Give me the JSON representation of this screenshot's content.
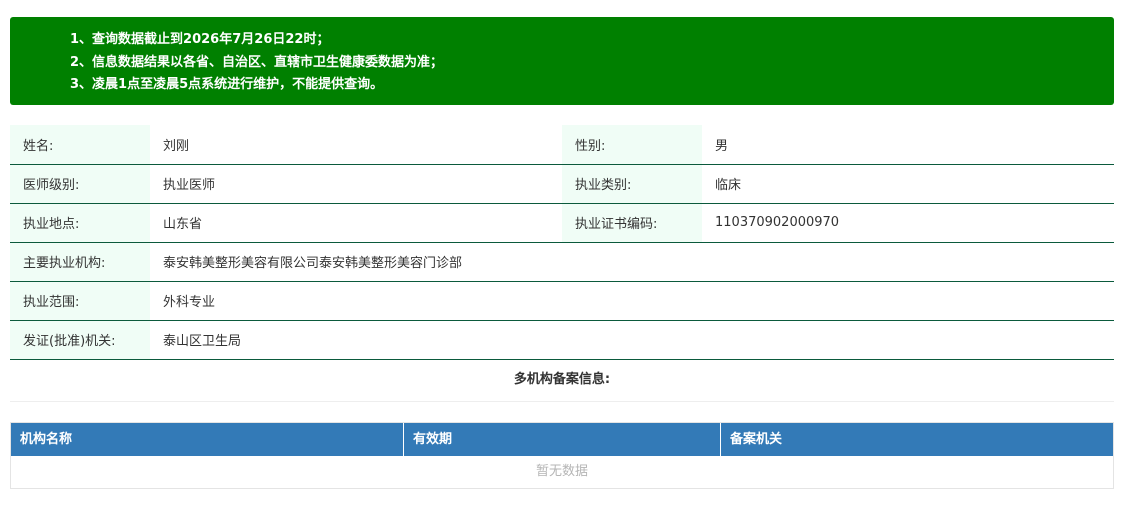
{
  "notice": {
    "lines": [
      "1、查询数据截止到2026年7月26日22时；",
      "2、信息数据结果以各省、自治区、直辖市卫生健康委数据为准；",
      "3、凌晨1点至凌晨5点系统进行维护，不能提供查询。"
    ],
    "color": "#008000"
  },
  "info": {
    "name_label": "姓名:",
    "name_value": "刘刚",
    "gender_label": "性别:",
    "gender_value": "男",
    "level_label": "医师级别:",
    "level_value": "执业医师",
    "category_label": "执业类别:",
    "category_value": "临床",
    "location_label": "执业地点:",
    "location_value": "山东省",
    "cert_label": "执业证书编码:",
    "cert_value": "110370902000970",
    "org_label": "主要执业机构:",
    "org_value": "泰安韩美整形美容有限公司泰安韩美整形美容门诊部",
    "scope_label": "执业范围:",
    "scope_value": "外科专业",
    "issuer_label": "发证(批准)机关:",
    "issuer_value": "泰山区卫生局"
  },
  "multi": {
    "title": "多机构备案信息:",
    "columns": [
      "机构名称",
      "有效期",
      "备案机关"
    ],
    "empty_text": "暂无数据",
    "header_color": "#337ab7"
  }
}
